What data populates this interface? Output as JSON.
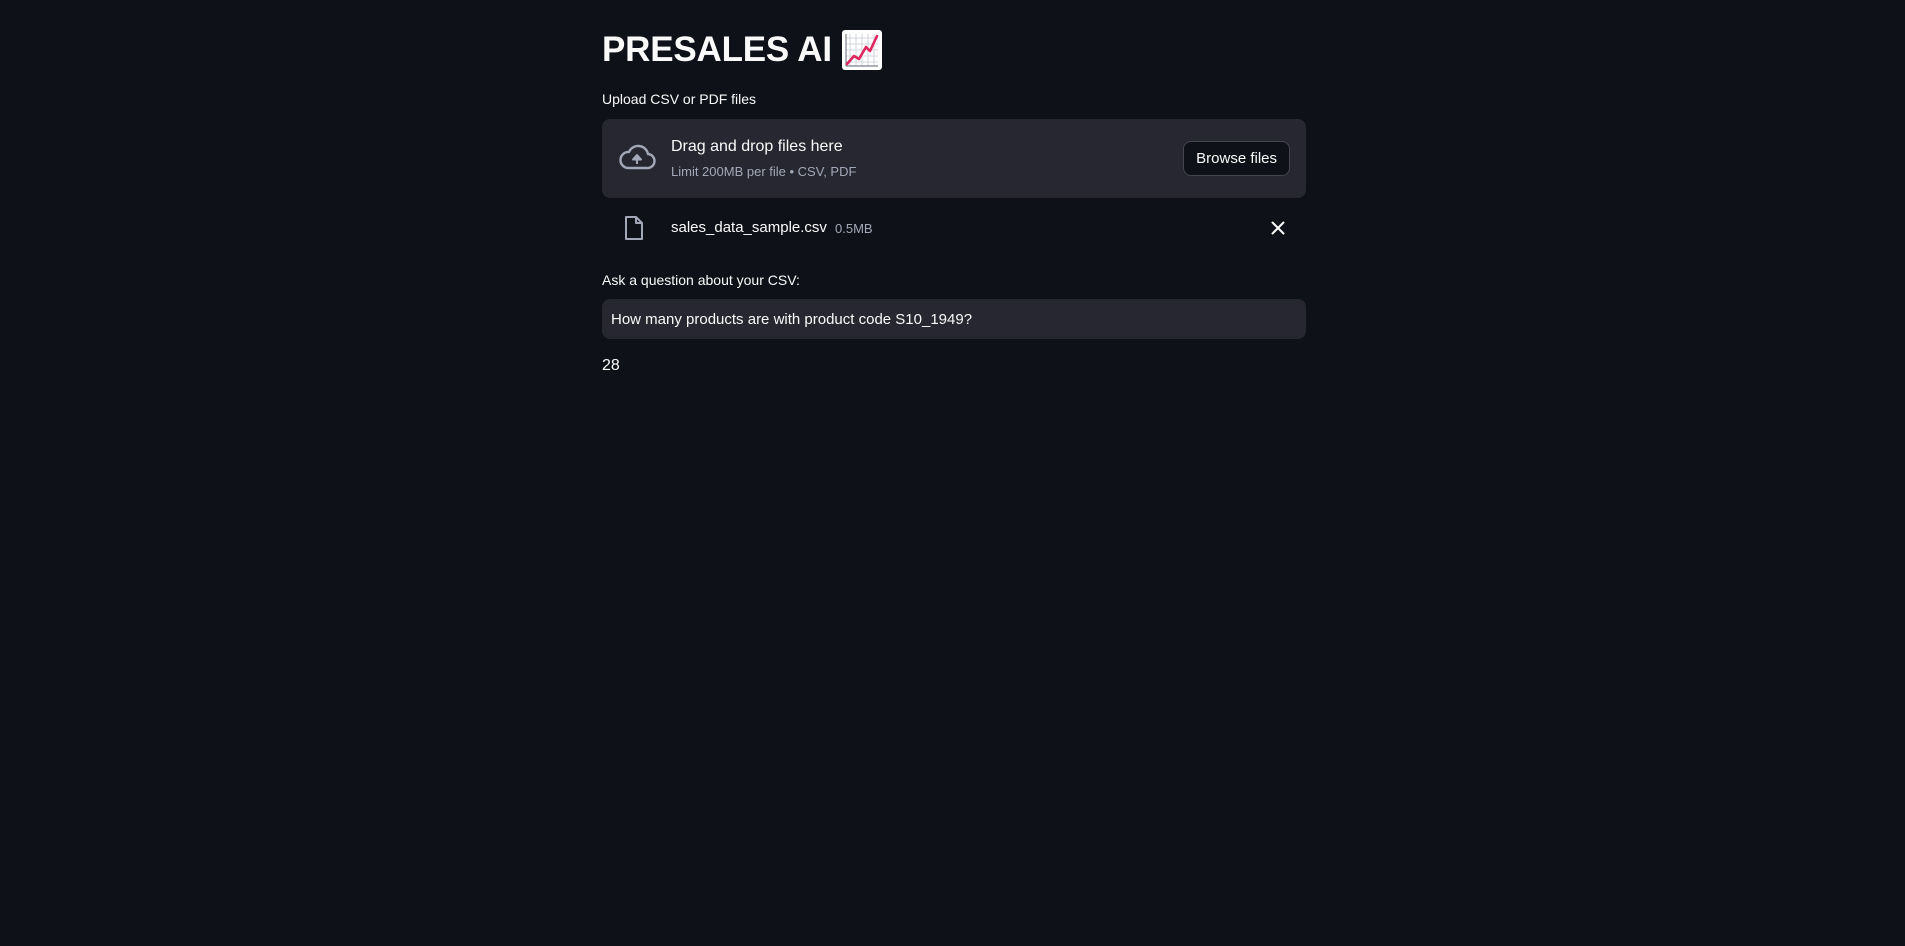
{
  "app": {
    "title": "PRESALES AI",
    "title_emoji_icon": "chart-increasing-icon"
  },
  "upload": {
    "label": "Upload CSV or PDF files",
    "dropzone_text": "Drag and drop files here",
    "dropzone_hint": "Limit 200MB per file • CSV, PDF",
    "browse_label": "Browse files",
    "icon": "cloud-upload-icon"
  },
  "uploaded_file": {
    "name": "sales_data_sample.csv",
    "size": "0.5MB",
    "icon": "file-icon",
    "remove_icon": "close-icon"
  },
  "question": {
    "label": "Ask a question about your CSV:",
    "value": "How many products are with product code S10_1949?"
  },
  "answer": {
    "text": "28"
  },
  "colors": {
    "background": "#0e1117",
    "panel": "#262730",
    "text": "#fafafa",
    "muted": "#a3a8b8"
  }
}
